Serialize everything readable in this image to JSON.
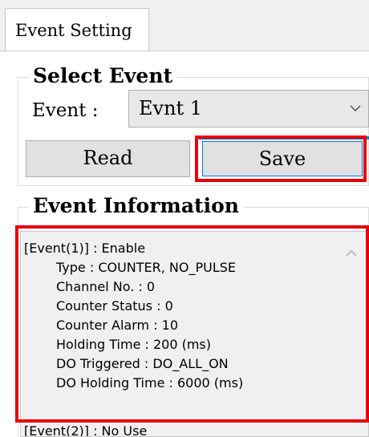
{
  "tab": {
    "label": "Event Setting"
  },
  "select_event": {
    "title": "Select Event",
    "event_label": "Event :",
    "event_value": "Evnt 1",
    "read_label": "Read",
    "save_label": "Save"
  },
  "event_information": {
    "title": "Event Information",
    "lines": [
      "[Event(1)] : Enable",
      "Type : COUNTER, NO_PULSE",
      "Channel No. : 0",
      "Counter Status : 0",
      "Counter Alarm : 10",
      "Holding Time : 200 (ms)",
      "DO Triggered : DO_ALL_ON",
      "DO Holding Time : 6000 (ms)",
      "[Event(2)] : No Use"
    ]
  },
  "colors": {
    "highlight": "#e8000b",
    "focus": "#0078d7",
    "panel": "#f0f0f0"
  },
  "icons": {
    "dropdown": "chevron-down-icon",
    "scroll": "chevron-up-icon"
  }
}
